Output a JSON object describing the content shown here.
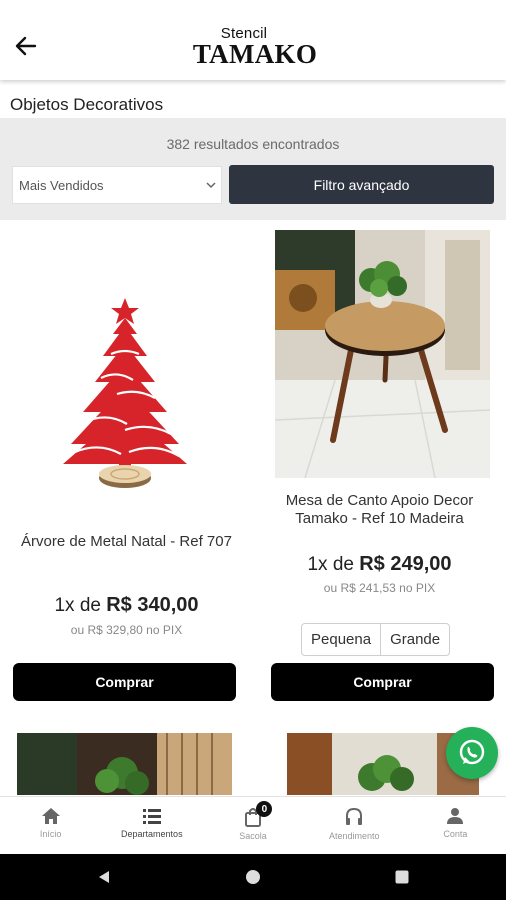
{
  "header": {
    "logo_small": "Stencil",
    "logo_big": "TAMAKO"
  },
  "page_title": "Objetos Decorativos",
  "filters": {
    "results_text": "382 resultados encontrados",
    "sort_selected": "Mais Vendidos",
    "advanced_filter_label": "Filtro avançado"
  },
  "products": [
    {
      "name": "Árvore de Metal Natal - Ref 707",
      "price_prefix": "1x de",
      "price": "R$ 340,00",
      "pix": "ou R$ 329,80 no PIX",
      "buy_label": "Comprar"
    },
    {
      "name": "Mesa de Canto Apoio Decor Tamako - Ref 10 Madeira",
      "price_prefix": "1x de",
      "price": "R$ 249,00",
      "pix": "ou R$ 241,53 no PIX",
      "variants": [
        "Pequena",
        "Grande"
      ],
      "buy_label": "Comprar"
    }
  ],
  "bottom_nav": {
    "items": [
      {
        "label": "Início",
        "icon": "home-icon"
      },
      {
        "label": "Departamentos",
        "icon": "list-icon"
      },
      {
        "label": "Sacola",
        "icon": "bag-icon",
        "badge": "0"
      },
      {
        "label": "Atendimento",
        "icon": "headset-icon"
      },
      {
        "label": "Conta",
        "icon": "person-icon"
      }
    ]
  },
  "colors": {
    "primary_dark": "#2e3541",
    "buy_button": "#000000",
    "whatsapp": "#25b05a",
    "filter_bg": "#ebebeb"
  }
}
